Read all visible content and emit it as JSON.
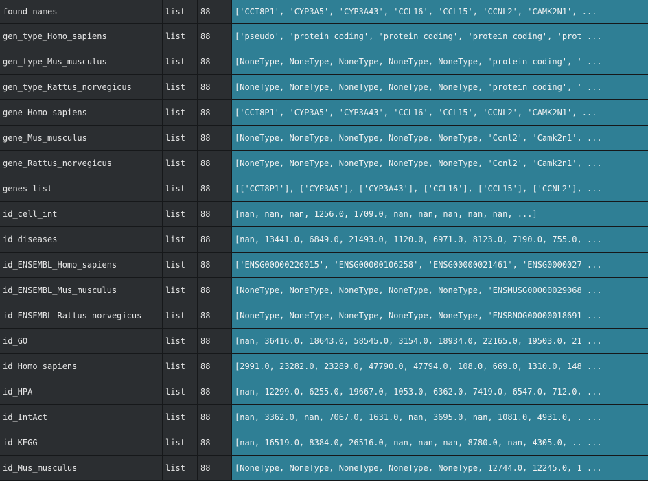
{
  "rows": [
    {
      "name": "found_names",
      "type": "list",
      "size": "88",
      "value": "['CCT8P1', 'CYP3A5', 'CYP3A43', 'CCL16', 'CCL15', 'CCNL2', 'CAMK2N1', ..."
    },
    {
      "name": "gen_type_Homo_sapiens",
      "type": "list",
      "size": "88",
      "value": "['pseudo', 'protein coding', 'protein coding', 'protein coding', 'prot ..."
    },
    {
      "name": "gen_type_Mus_musculus",
      "type": "list",
      "size": "88",
      "value": "[NoneType, NoneType, NoneType, NoneType, NoneType, 'protein coding', ' ..."
    },
    {
      "name": "gen_type_Rattus_norvegicus",
      "type": "list",
      "size": "88",
      "value": "[NoneType, NoneType, NoneType, NoneType, NoneType, 'protein coding', ' ..."
    },
    {
      "name": "gene_Homo_sapiens",
      "type": "list",
      "size": "88",
      "value": "['CCT8P1', 'CYP3A5', 'CYP3A43', 'CCL16', 'CCL15', 'CCNL2', 'CAMK2N1', ..."
    },
    {
      "name": "gene_Mus_musculus",
      "type": "list",
      "size": "88",
      "value": "[NoneType, NoneType, NoneType, NoneType, NoneType, 'Ccnl2', 'Camk2n1', ..."
    },
    {
      "name": "gene_Rattus_norvegicus",
      "type": "list",
      "size": "88",
      "value": "[NoneType, NoneType, NoneType, NoneType, NoneType, 'Ccnl2', 'Camk2n1', ..."
    },
    {
      "name": "genes_list",
      "type": "list",
      "size": "88",
      "value": "[['CCT8P1'], ['CYP3A5'], ['CYP3A43'], ['CCL16'], ['CCL15'], ['CCNL2'], ..."
    },
    {
      "name": "id_cell_int",
      "type": "list",
      "size": "88",
      "value": "[nan, nan, nan, 1256.0, 1709.0, nan, nan, nan, nan, nan, ...]"
    },
    {
      "name": "id_diseases",
      "type": "list",
      "size": "88",
      "value": "[nan, 13441.0, 6849.0, 21493.0, 1120.0, 6971.0, 8123.0, 7190.0, 755.0, ..."
    },
    {
      "name": "id_ENSEMBL_Homo_sapiens",
      "type": "list",
      "size": "88",
      "value": "['ENSG00000226015', 'ENSG00000106258', 'ENSG00000021461', 'ENSG0000027 ..."
    },
    {
      "name": "id_ENSEMBL_Mus_musculus",
      "type": "list",
      "size": "88",
      "value": "[NoneType, NoneType, NoneType, NoneType, NoneType, 'ENSMUSG00000029068 ..."
    },
    {
      "name": "id_ENSEMBL_Rattus_norvegicus",
      "type": "list",
      "size": "88",
      "value": "[NoneType, NoneType, NoneType, NoneType, NoneType, 'ENSRNOG00000018691 ..."
    },
    {
      "name": "id_GO",
      "type": "list",
      "size": "88",
      "value": "[nan, 36416.0, 18643.0, 58545.0, 3154.0, 18934.0, 22165.0, 19503.0, 21 ..."
    },
    {
      "name": "id_Homo_sapiens",
      "type": "list",
      "size": "88",
      "value": "[2991.0, 23282.0, 23289.0, 47790.0, 47794.0, 108.0, 669.0, 1310.0, 148 ..."
    },
    {
      "name": "id_HPA",
      "type": "list",
      "size": "88",
      "value": "[nan, 12299.0, 6255.0, 19667.0, 1053.0, 6362.0, 7419.0, 6547.0, 712.0, ..."
    },
    {
      "name": "id_IntAct",
      "type": "list",
      "size": "88",
      "value": "[nan, 3362.0, nan, 7067.0, 1631.0, nan, 3695.0, nan, 1081.0, 4931.0, . ..."
    },
    {
      "name": "id_KEGG",
      "type": "list",
      "size": "88",
      "value": "[nan, 16519.0, 8384.0, 26516.0, nan, nan, nan, 8780.0, nan, 4305.0, .. ..."
    },
    {
      "name": "id_Mus_musculus",
      "type": "list",
      "size": "88",
      "value": "[NoneType, NoneType, NoneType, NoneType, NoneType, 12744.0, 12245.0, 1 ..."
    }
  ]
}
